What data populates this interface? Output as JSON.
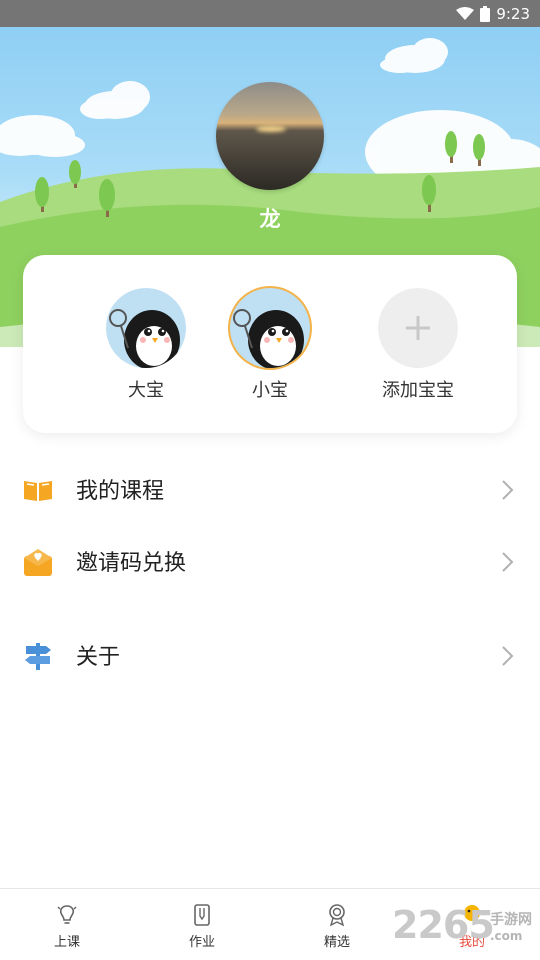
{
  "status_bar": {
    "time": "9:23"
  },
  "profile": {
    "name": "龙"
  },
  "kids": [
    {
      "label": "大宝",
      "selected": false
    },
    {
      "label": "小宝",
      "selected": true
    },
    {
      "label": "添加宝宝",
      "icon": "plus-icon"
    }
  ],
  "menu": [
    {
      "label": "我的课程",
      "icon": "open-book-icon",
      "color": "#f5a623"
    },
    {
      "label": "邀请码兑换",
      "icon": "envelope-heart-icon",
      "color": "#f5a623"
    },
    {
      "label": "关于",
      "icon": "signpost-icon",
      "color": "#4a90d9"
    }
  ],
  "tabs": [
    {
      "label": "上课",
      "icon": "lightbulb-icon",
      "active": false
    },
    {
      "label": "作业",
      "icon": "pencil-book-icon",
      "active": false
    },
    {
      "label": "精选",
      "icon": "badge-icon",
      "active": false
    },
    {
      "label": "我的",
      "icon": "duck-icon",
      "active": true
    }
  ],
  "watermark": {
    "number": "2265",
    "site": "手游网",
    "domain": ".com"
  },
  "colors": {
    "accent": "#e74c3c",
    "sky": "#8fcff4",
    "grass": "#8fd15f",
    "menu_orange": "#f5a623",
    "menu_blue": "#4a90d9"
  }
}
